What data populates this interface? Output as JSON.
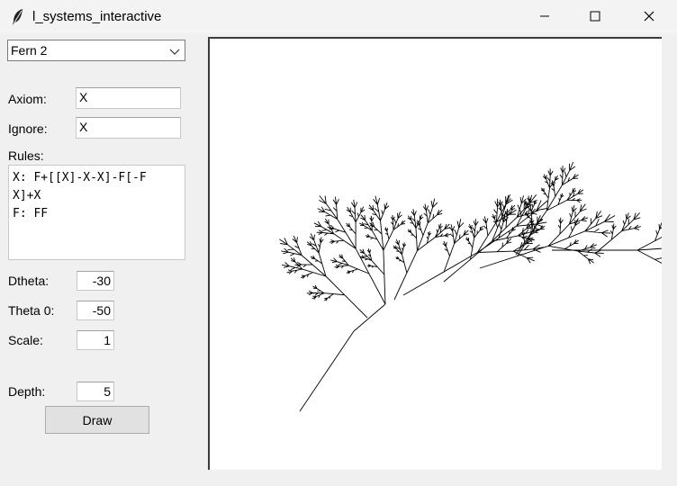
{
  "window": {
    "title": "l_systems_interactive"
  },
  "preset": {
    "selected": "Fern 2"
  },
  "form": {
    "axiom_label": "Axiom:",
    "axiom_value": "X",
    "ignore_label": "Ignore:",
    "ignore_value": "X",
    "rules_label": "Rules:",
    "rules_value": "X: F+[[X]-X-X]-F[-F\nX]+X\nF: FF",
    "dtheta_label": "Dtheta:",
    "dtheta_value": "-30",
    "theta0_label": "Theta 0:",
    "theta0_value": "-50",
    "scale_label": "Scale:",
    "scale_value": "1",
    "depth_label": "Depth:",
    "depth_value": "5",
    "draw_label": "Draw"
  },
  "icons": {
    "app": "feather-icon",
    "minimize": "minimize-icon",
    "maximize": "maximize-icon",
    "close": "close-icon",
    "dropdown": "chevron-down-icon"
  }
}
